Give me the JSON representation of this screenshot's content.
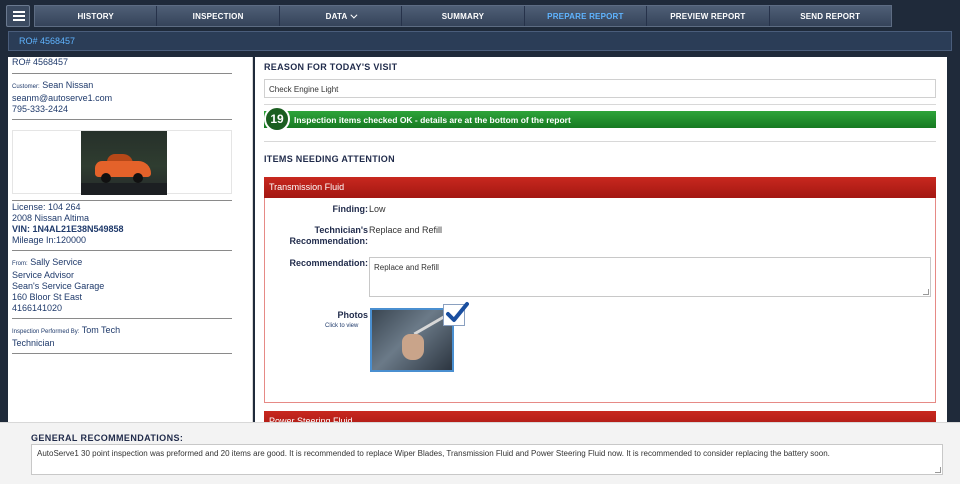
{
  "nav": {
    "tabs": [
      {
        "label": "HISTORY"
      },
      {
        "label": "INSPECTION"
      },
      {
        "label": "DATA"
      },
      {
        "label": "SUMMARY"
      },
      {
        "label": "PREPARE REPORT"
      },
      {
        "label": "PREVIEW REPORT"
      },
      {
        "label": "SEND REPORT"
      }
    ],
    "active_color": "#5fb4ff"
  },
  "ro_bar": {
    "text": "RO# 4568457"
  },
  "left": {
    "ro": "RO# 4568457",
    "customer_label": "Customer:",
    "customer_name": "Sean Nissan",
    "email": "seanm@autoserve1.com",
    "phone": "795-333-2424",
    "license": "License: 104 264",
    "vehicle": "2008 Nissan Altima",
    "vin": "VIN: 1N4AL21E38N549858",
    "mileage": "Mileage In:120000",
    "from_label": "From:",
    "from_name": "Sally Service",
    "from_role": "Service Advisor",
    "garage": "Sean's Service Garage",
    "address": "160 Bloor St East",
    "garage_phone": "4166141020",
    "inspector_label": "Inspection Performed By:",
    "inspector_name": "Tom Tech",
    "inspector_role": "Technician"
  },
  "main": {
    "reason_heading": "REASON FOR TODAY'S VISIT",
    "reason_value": "Check Engine Light",
    "ok_count": "19",
    "ok_text": "Inspection items checked OK - details are at the bottom of the report",
    "attention_heading": "ITEMS NEEDING ATTENTION",
    "item1": {
      "title": "Transmission Fluid",
      "finding_label": "Finding:",
      "finding_value": "Low",
      "tech_label_1": "Technician's",
      "tech_label_2": "Recommendation:",
      "tech_value": "Replace and Refill",
      "rec_label": "Recommendation:",
      "rec_value": "Replace and Refill",
      "photos_label": "Photos",
      "photos_hint": "Click to view"
    },
    "item2": {
      "title": "Power Steering Fluid"
    }
  },
  "bottom": {
    "title": "GENERAL RECOMMENDATIONS:",
    "text": "AutoServe1 30 point inspection was preformed and 20 items are good.   It is recommended to replace Wiper Blades, Transmission Fluid and Power Steering Fluid now.  It is recommended to consider replacing the battery soon."
  },
  "colors": {
    "ok_green": "#177a22",
    "item_red": "#a31712",
    "link_blue": "#1f3a6b"
  }
}
